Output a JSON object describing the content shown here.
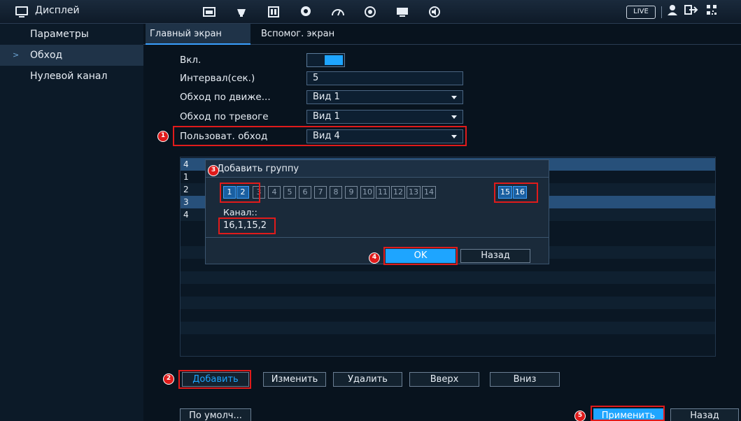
{
  "header": {
    "title": "Дисплей",
    "icons": [
      "display-settings-icon",
      "camera-icon",
      "storage-icon",
      "ai-icon",
      "performance-icon",
      "network-icon",
      "monitor-icon",
      "audio-icon"
    ],
    "live_label": "LIVE"
  },
  "sidebar": {
    "items": [
      {
        "label": "Параметры",
        "active": false
      },
      {
        "label": "Обход",
        "active": true
      },
      {
        "label": "Нулевой канал",
        "active": false
      }
    ]
  },
  "tabs": [
    {
      "label": "Главный экран",
      "active": true
    },
    {
      "label": "Вспомог. экран",
      "active": false
    }
  ],
  "form": {
    "enable_label": "Вкл.",
    "enable_on": true,
    "interval_label": "Интервал(сек.)",
    "interval_value": "5",
    "motion_label": "Обход по движе...",
    "motion_value": "Вид 1",
    "alarm_label": "Обход по тревоге",
    "alarm_value": "Вид 1",
    "user_label": "Пользоват. обход",
    "user_value": "Вид 4"
  },
  "table": {
    "rows": [
      "4",
      "1",
      "2",
      "3",
      "4"
    ]
  },
  "dialog": {
    "title": "Добавить группу",
    "channels": [
      "1",
      "2",
      "3",
      "4",
      "5",
      "6",
      "7",
      "8",
      "9",
      "10",
      "11",
      "12",
      "13",
      "14",
      "15",
      "16"
    ],
    "selected_channels": [
      "1",
      "2",
      "15",
      "16"
    ],
    "channel_label": "Канал::",
    "channel_value": "16,1,15,2",
    "ok_label": "OK",
    "back_label": "Назад"
  },
  "actions": {
    "add": "Добавить",
    "edit": "Изменить",
    "delete": "Удалить",
    "up": "Вверх",
    "down": "Вниз"
  },
  "footer": {
    "default_label": "По умолч...",
    "apply_label": "Применить",
    "back_label": "Назад"
  },
  "steps": [
    "1",
    "2",
    "3",
    "4",
    "5"
  ]
}
